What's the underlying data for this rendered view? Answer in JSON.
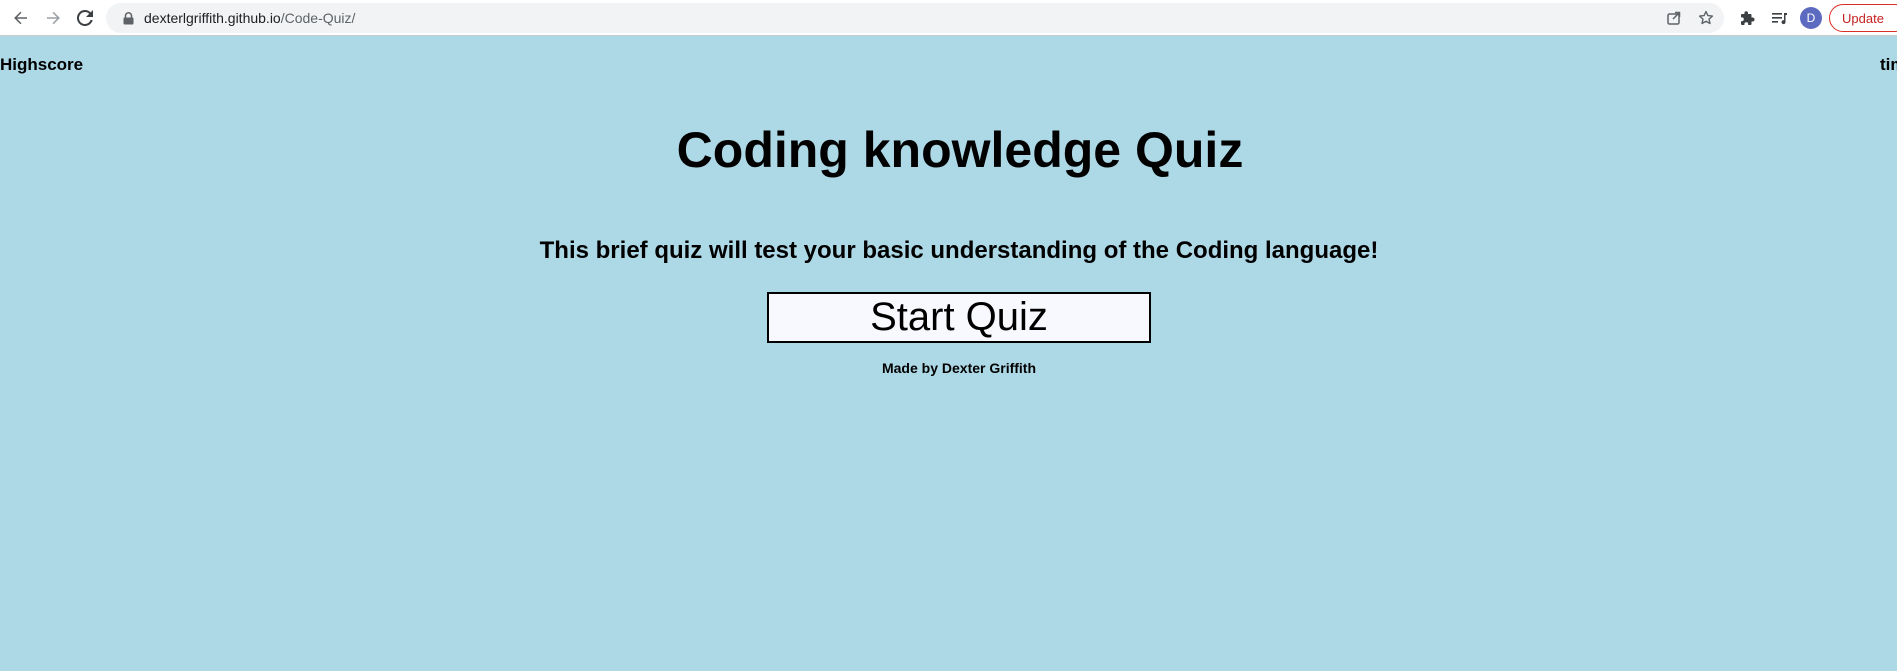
{
  "browser": {
    "url_host": "dexterlgriffith.github.io",
    "url_path": "/Code-Quiz/",
    "avatar_letter": "D",
    "update_label": "Update",
    "update_menu_glyph": "⋮",
    "icons": [
      "back-arrow-icon",
      "forward-arrow-icon",
      "reload-icon",
      "lock-icon",
      "share-icon",
      "star-icon",
      "extensions-icon",
      "media-queue-icon"
    ]
  },
  "page": {
    "highscore_label": "Highscore",
    "timer_label": "time",
    "title": "Coding knowledge Quiz",
    "description": "This brief quiz will test your basic understanding of the Coding language!",
    "start_button_label": "Start Quiz",
    "credit": "Made by Dexter Griffith"
  },
  "colors": {
    "page_background": "#ADD8E6",
    "button_background": "#F8F8FF",
    "text": "#000000",
    "update_accent": "#D93025",
    "avatar": "#5C6BC0"
  }
}
